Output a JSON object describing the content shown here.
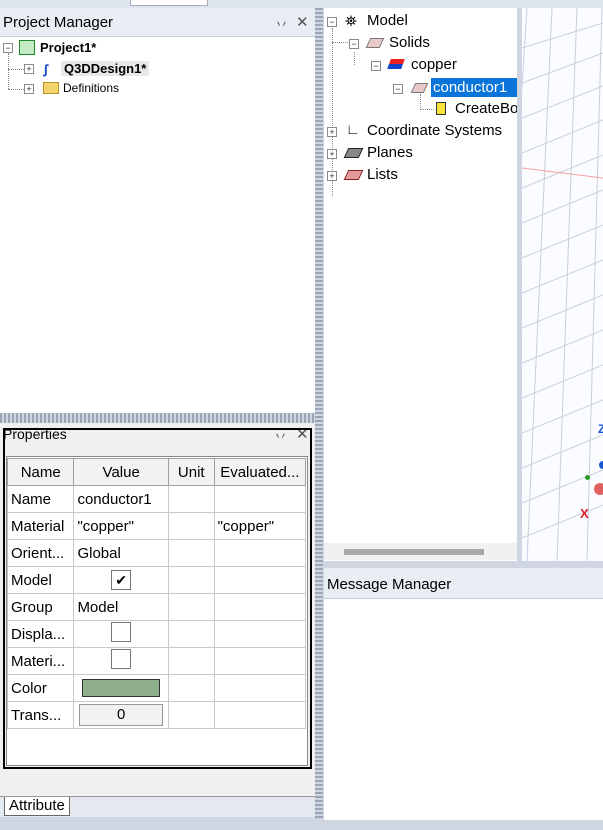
{
  "project_manager": {
    "title": "Project Manager",
    "project": "Project1*",
    "design": "Q3DDesign1*",
    "definitions": "Definitions"
  },
  "model_tree": {
    "model": "Model",
    "solids": "Solids",
    "material": "copper",
    "object": "conductor1",
    "create": "CreateBo",
    "coordinate_systems": "Coordinate Systems",
    "planes": "Planes",
    "lists": "Lists"
  },
  "viewport": {
    "axis_z": "Z",
    "axis_x": "X"
  },
  "properties": {
    "title": "Properties",
    "headers": [
      "Name",
      "Value",
      "Unit",
      "Evaluated..."
    ],
    "rows": [
      {
        "name": "Name",
        "value": "conductor1",
        "unit": "",
        "evaluated": ""
      },
      {
        "name": "Material",
        "value": "\"copper\"",
        "unit": "",
        "evaluated": "\"copper\""
      },
      {
        "name": "Orient...",
        "value": "Global",
        "unit": "",
        "evaluated": ""
      },
      {
        "name": "Model",
        "value": "",
        "unit": "",
        "evaluated": ""
      },
      {
        "name": "Group",
        "value": "Model",
        "unit": "",
        "evaluated": ""
      },
      {
        "name": "Displa...",
        "value": "",
        "unit": "",
        "evaluated": ""
      },
      {
        "name": "Materi...",
        "value": "",
        "unit": "",
        "evaluated": ""
      },
      {
        "name": "Color",
        "value": "",
        "unit": "",
        "evaluated": ""
      },
      {
        "name": "Trans...",
        "value": "0",
        "unit": "",
        "evaluated": ""
      }
    ],
    "model_checked": true,
    "display_checked": false,
    "material_checked": false,
    "color_swatch": "#8fae8c",
    "tab": "Attribute"
  },
  "message_manager": {
    "title": "Message Manager"
  },
  "colors": {
    "selection": "#0a74da",
    "red_axis": "#e02020",
    "blue_axis": "#1a55d6"
  }
}
